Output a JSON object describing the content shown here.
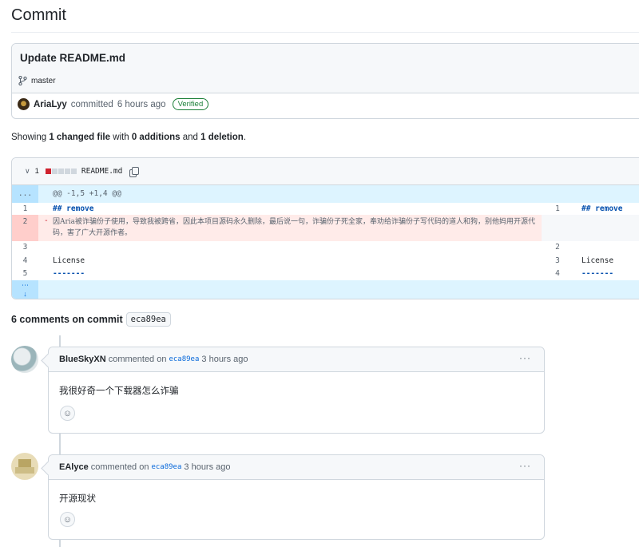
{
  "page": {
    "title": "Commit"
  },
  "commit": {
    "message": "Update README.md",
    "branch": "master",
    "author": "AriaLyy",
    "action": "committed",
    "time": "6 hours ago",
    "badge": "Verified"
  },
  "summary": {
    "prefix": "Showing ",
    "changed_count": "1 changed file",
    "with": " with ",
    "additions": "0 additions",
    "and": " and ",
    "deletions": "1 deletion",
    "suffix": "."
  },
  "diff": {
    "toggle_icon": "chevron-down-icon",
    "change_count": "1",
    "filename": "README.md",
    "hunk_gutter": "...",
    "hunk_header": "@@ -1,5 +1,4 @@",
    "left_lines": [
      {
        "num": "1",
        "text": "## remove"
      },
      {
        "num": "2",
        "sign": "-",
        "text": "因Aria被诈骗份子使用，导致我被跨省，因此本项目源码永久删除，最后说一句，诈骗份子死全家，奉劝给诈骗份子写代码的道人和狗，别他妈用开源代码，害了广大开源作者。"
      },
      {
        "num": "3",
        "text": ""
      },
      {
        "num": "4",
        "text": "License"
      },
      {
        "num": "5",
        "text": "-------"
      }
    ],
    "right_lines": [
      {
        "num": "1",
        "text": "## remove"
      },
      {
        "num": "2",
        "text": ""
      },
      {
        "num": "3",
        "text": "License"
      },
      {
        "num": "4",
        "text": "-------"
      }
    ],
    "colors": {
      "deleted_bg": "#ffebe9",
      "deleted_gutter": "#ffcecb",
      "hunk_bg": "#ddf4ff"
    }
  },
  "comments_section": {
    "title": "6 comments on commit",
    "sha": "eca89ea"
  },
  "comments": [
    {
      "user": "BlueSkyXN",
      "verb": "commented on",
      "sha": "eca89ea",
      "time": "3 hours ago",
      "body": "我很好奇一个下载器怎么诈骗"
    },
    {
      "user": "EAlyce",
      "verb": "commented on",
      "sha": "eca89ea",
      "time": "3 hours ago",
      "body": "开源现状"
    }
  ]
}
